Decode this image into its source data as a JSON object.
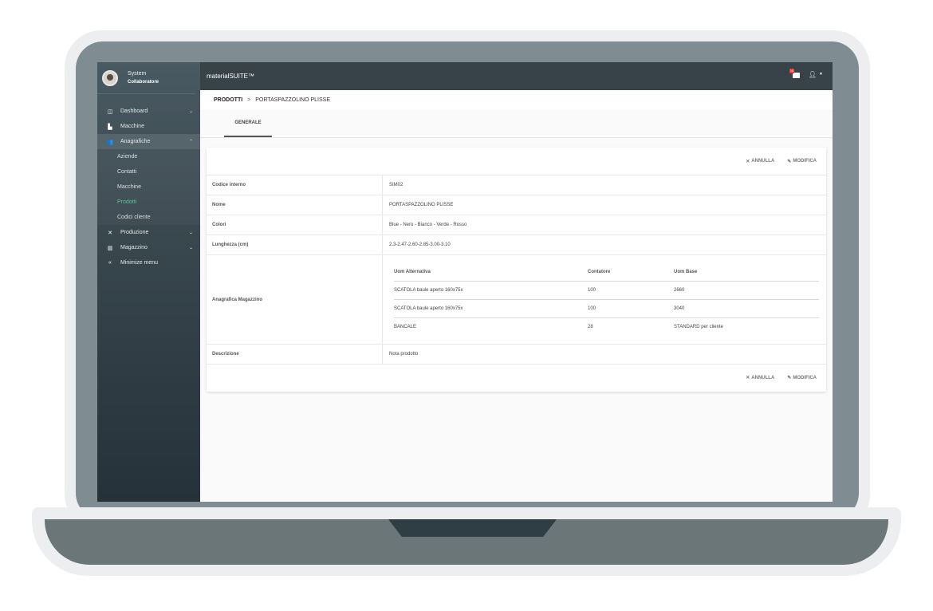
{
  "sidebar": {
    "user_name": "System",
    "user_role": "Collaboratore",
    "items": [
      {
        "label": "Dashboard",
        "icon": "dashboard-icon",
        "chevron": "⌄"
      },
      {
        "label": "Macchine",
        "icon": "factory-icon",
        "chevron": ""
      },
      {
        "label": "Anagrafiche",
        "icon": "people-icon",
        "chevron": "⌃"
      }
    ],
    "subitems": [
      "Aziende",
      "Contatti",
      "Macchine",
      "Prodotti",
      "Codici cliente"
    ],
    "items2": [
      {
        "label": "Produzione",
        "icon": "tools-icon",
        "chevron": "⌄"
      },
      {
        "label": "Magazzino",
        "icon": "warehouse-icon",
        "chevron": "⌄"
      },
      {
        "label": "Minimize menu",
        "icon": "double-chevron-left-icon",
        "chevron": ""
      }
    ]
  },
  "topbar": {
    "brand": "materialSUITE™",
    "notification_count": "10"
  },
  "breadcrumb": {
    "root": "PRODOTTI",
    "separator": ">",
    "current": "PORTASPAZZOLINO PLISSE"
  },
  "tabs": [
    "GENERALE"
  ],
  "actions": {
    "cancel": "ANNULLA",
    "edit": "MODIFICA"
  },
  "fields": [
    {
      "label": "Codice interno",
      "value": "SIM02"
    },
    {
      "label": "Nome",
      "value": "PORTASPAZZOLINO PLISSE"
    },
    {
      "label": "Colori",
      "value": "Blue - Nero - Bianco - Verde - Rosso"
    },
    {
      "label": "Lunghezza (cm)",
      "value": "2.3-2.47-2.60-2.85-3.00-3.10"
    }
  ],
  "magazzino": {
    "label": "Anagrafica Magazzino",
    "headers": [
      "Uom Alternativa",
      "Contatore",
      "Uom Base"
    ],
    "rows": [
      [
        "SCATOLA baule aperto 160x75x",
        "100",
        "2660"
      ],
      [
        "SCATOLA baule aperto 160x75x",
        "100",
        "3040"
      ],
      [
        "BANCALE",
        "28",
        "STANDARD per cliente"
      ]
    ]
  },
  "descrizione": {
    "label": "Descrizione",
    "value": "Nota prodotto"
  },
  "colors": {
    "topbar": "#374349",
    "sidebar": "#3b4950",
    "accent_active": "#4ec995",
    "badge": "#e53935"
  }
}
